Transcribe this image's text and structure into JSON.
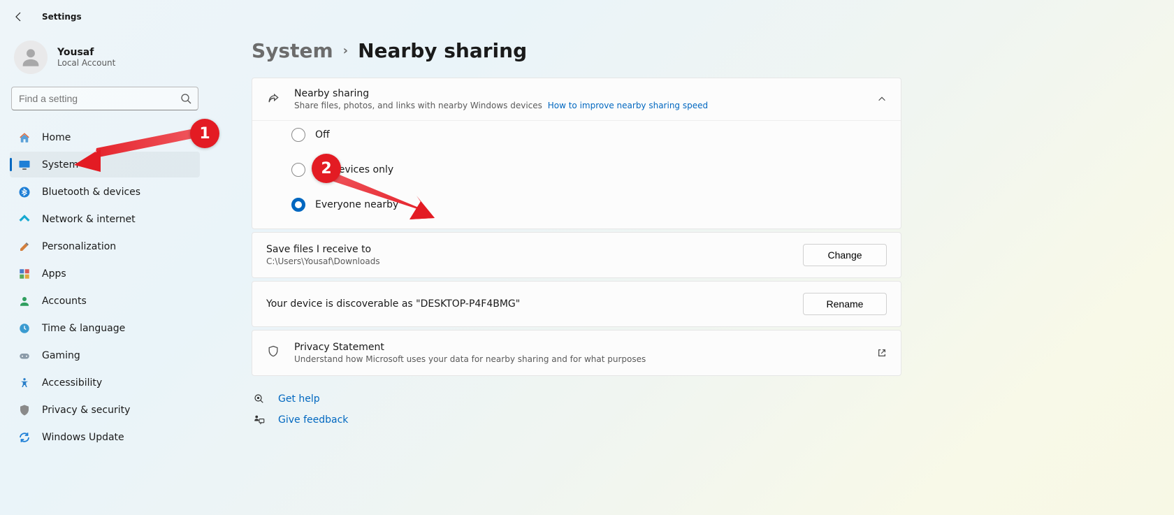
{
  "app": {
    "title": "Settings"
  },
  "user": {
    "name": "Yousaf",
    "subtitle": "Local Account"
  },
  "search": {
    "placeholder": "Find a setting"
  },
  "nav": {
    "home": "Home",
    "system": "System",
    "bluetooth": "Bluetooth & devices",
    "network": "Network & internet",
    "personalization": "Personalization",
    "apps": "Apps",
    "accounts": "Accounts",
    "time": "Time & language",
    "gaming": "Gaming",
    "accessibility": "Accessibility",
    "privacy": "Privacy & security",
    "update": "Windows Update",
    "active": "system"
  },
  "breadcrumb": {
    "parent": "System",
    "current": "Nearby sharing"
  },
  "sharing": {
    "title": "Nearby sharing",
    "subtitle": "Share files, photos, and links with nearby Windows devices",
    "help_link": "How to improve nearby sharing speed",
    "options": {
      "off": "Off",
      "mine": "My devices only",
      "everyone": "Everyone nearby",
      "selected": "everyone"
    }
  },
  "save": {
    "title": "Save files I receive to",
    "path": "C:\\Users\\Yousaf\\Downloads",
    "button": "Change"
  },
  "discover": {
    "text": "Your device is discoverable as \"DESKTOP-P4F4BMG\"",
    "button": "Rename"
  },
  "privacy": {
    "title": "Privacy Statement",
    "subtitle": "Understand how Microsoft uses your data for nearby sharing and for what purposes"
  },
  "footer": {
    "help": "Get help",
    "feedback": "Give feedback"
  },
  "annotations": {
    "one": "1",
    "two": "2"
  }
}
